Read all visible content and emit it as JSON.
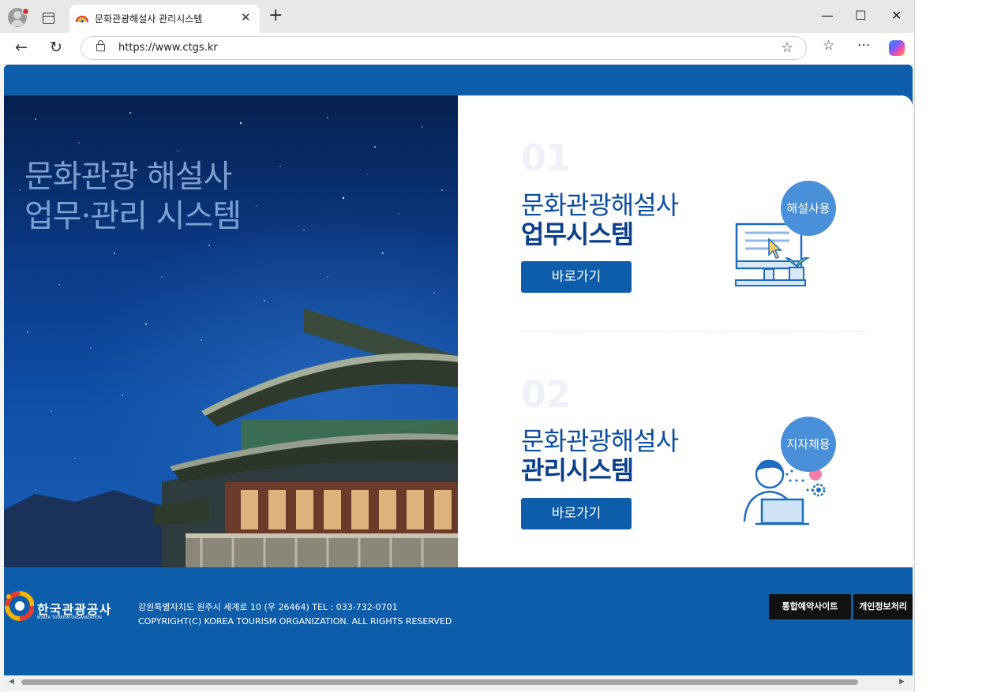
{
  "browser": {
    "tab_title": "문화관광해설사 관리시스템",
    "tab_close": "✕",
    "new_tab": "+",
    "url": "https://www.ctgs.kr",
    "minimize": "—",
    "maximize": "☐",
    "close": "✕",
    "back": "←",
    "reload": "↻",
    "favorite_star": "☆",
    "favorites": "☆",
    "more": "···"
  },
  "hero": {
    "line1": "문화관광 해설사",
    "line2": "업무·관리 시스템"
  },
  "systems": [
    {
      "number": "01",
      "title": "문화관광해설사",
      "subtitle": "업무시스템",
      "button": "바로가기",
      "bubble": "해설사용",
      "icon": "computer-monitor-icon"
    },
    {
      "number": "02",
      "title": "문화관광해설사",
      "subtitle": "관리시스템",
      "button": "바로가기",
      "bubble": "지자체용",
      "icon": "person-laptop-icon"
    }
  ],
  "footer": {
    "logo_name": "한국관광공사",
    "logo_sub": "KOREA TOURISM ORGANIZATION",
    "address": "강원특별자치도 원주시 세계로 10 (우 26464) TEL : 033-732-0701",
    "copyright": "COPYRIGHT(C) KOREA TOURISM ORGANIZATION. ALL RIGHTS RESERVED",
    "btn_reservation": "통합예약사이트",
    "btn_privacy": "개인정보처리"
  },
  "colors": {
    "brand_blue": "#0d5dab",
    "bubble_blue": "#4a90d9",
    "title_blue": "#0c4da2"
  }
}
